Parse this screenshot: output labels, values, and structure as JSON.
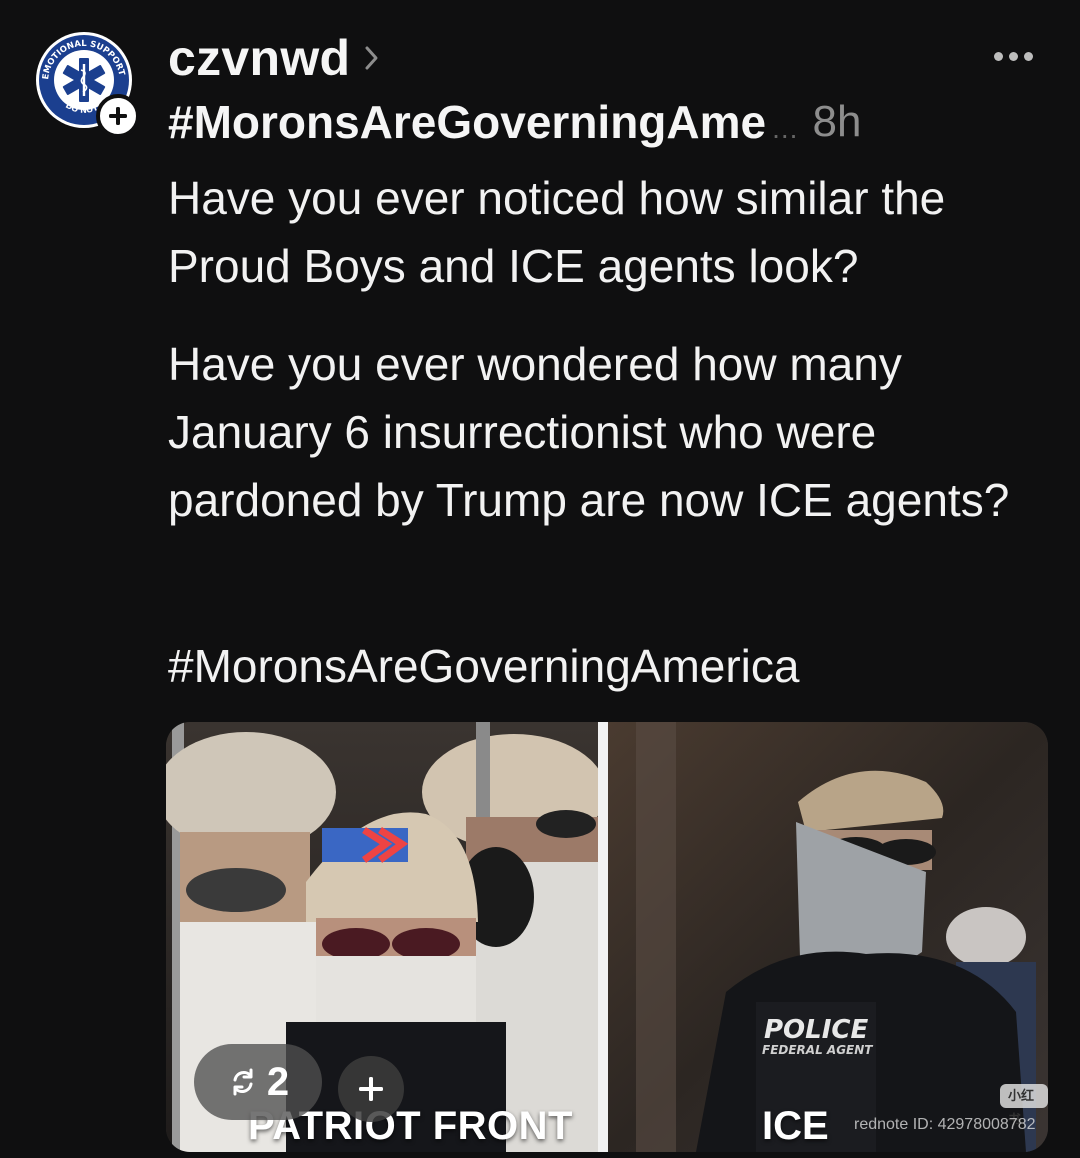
{
  "post": {
    "username": "czvnwd",
    "hashtag_truncated": "#MoronsAreGoverningAme",
    "ellipsis": "...",
    "time": "8h",
    "paragraph_1": "Have you ever noticed how similar the Proud Boys and ICE agents look?",
    "paragraph_2": "Have you ever wondered how many January 6 insurrectionist who were pardoned by Trump are now ICE agents?",
    "paragraph_3": "#MoronsAreGoverningAmerica"
  },
  "avatar": {
    "ring_text_top": "EMOTIONAL SUPPORT HUMAN",
    "ring_text_bottom": "DO NOT",
    "icon": "star-of-life-icon",
    "accent": "#1b3f8f"
  },
  "media": {
    "caption_left": "PATRIOT FRONT",
    "caption_right": "ICE",
    "vest_line_1": "POLICE",
    "vest_line_2": "FEDERAL AGENT",
    "watermark_logo": "小红书",
    "watermark_id": "rednote ID: 42978008782"
  },
  "actions": {
    "repost_count": "2",
    "repost_icon": "repost-icon",
    "add_icon": "plus-icon",
    "more_icon": "more-dots-icon"
  }
}
